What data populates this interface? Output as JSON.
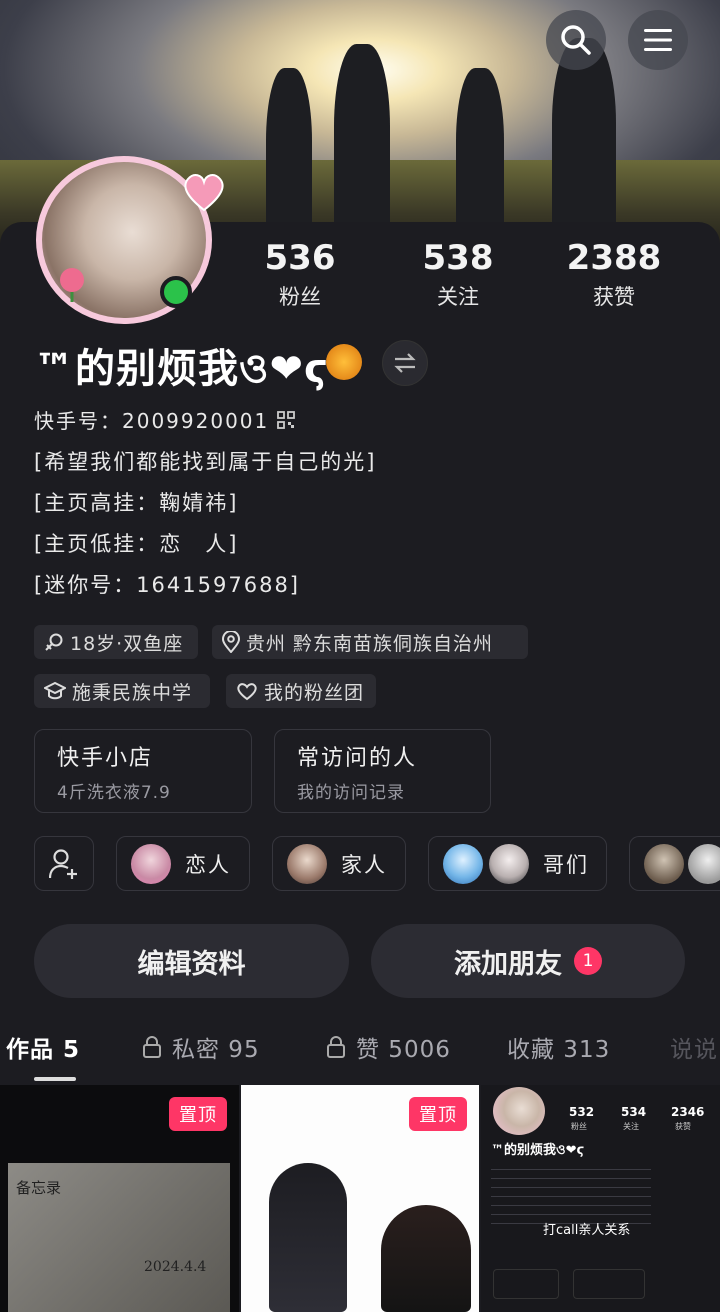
{
  "header": {
    "search_icon": "search-icon",
    "menu_icon": "menu-icon"
  },
  "stats": [
    {
      "value": "536",
      "label": "粉丝"
    },
    {
      "value": "538",
      "label": "关注"
    },
    {
      "value": "2388",
      "label": "获赞"
    }
  ],
  "profile": {
    "name": "™的别烦我ও❤ϛ",
    "id_line": "快手号：2009920001",
    "bio": [
      "[希望我们都能找到属于自己的光]",
      "[主页高挂：鞠婧祎]",
      "[主页低挂：恋　人]",
      "[迷你号：1641597688]"
    ]
  },
  "tags": {
    "age": "18岁·双鱼座",
    "location": "贵州 黔东南苗族侗族自治州",
    "school": "施秉民族中学",
    "fans_group": "我的粉丝团"
  },
  "boxes": [
    {
      "title": "快手小店",
      "subtitle": "4斤洗衣液7.9"
    },
    {
      "title": "常访问的人",
      "subtitle": "我的访问记录"
    }
  ],
  "relations": [
    {
      "label": "恋人"
    },
    {
      "label": "家人"
    },
    {
      "label": "哥们"
    }
  ],
  "actions": {
    "edit": "编辑资料",
    "add_friend": "添加朋友",
    "add_friend_badge": "1"
  },
  "tabs": [
    {
      "label": "作品 5"
    },
    {
      "label": "私密 95"
    },
    {
      "label": "赞 5006"
    },
    {
      "label": "收藏 313"
    },
    {
      "label": "说说"
    }
  ],
  "thumbs": [
    {
      "pin": "置顶",
      "memo_title": "备忘录",
      "memo_date": "2024.4.4"
    },
    {
      "pin": "置顶"
    },
    {
      "stats": [
        "532",
        "534",
        "2346"
      ],
      "stat_labels": [
        "粉丝",
        "关注",
        "获赞"
      ],
      "name": "™的别烦我ও❤ϛ",
      "overlay_text": "打call亲人关系"
    }
  ],
  "colors": {
    "accent": "#fe3666",
    "online": "#2bc24a",
    "background": "#1c1c21"
  }
}
